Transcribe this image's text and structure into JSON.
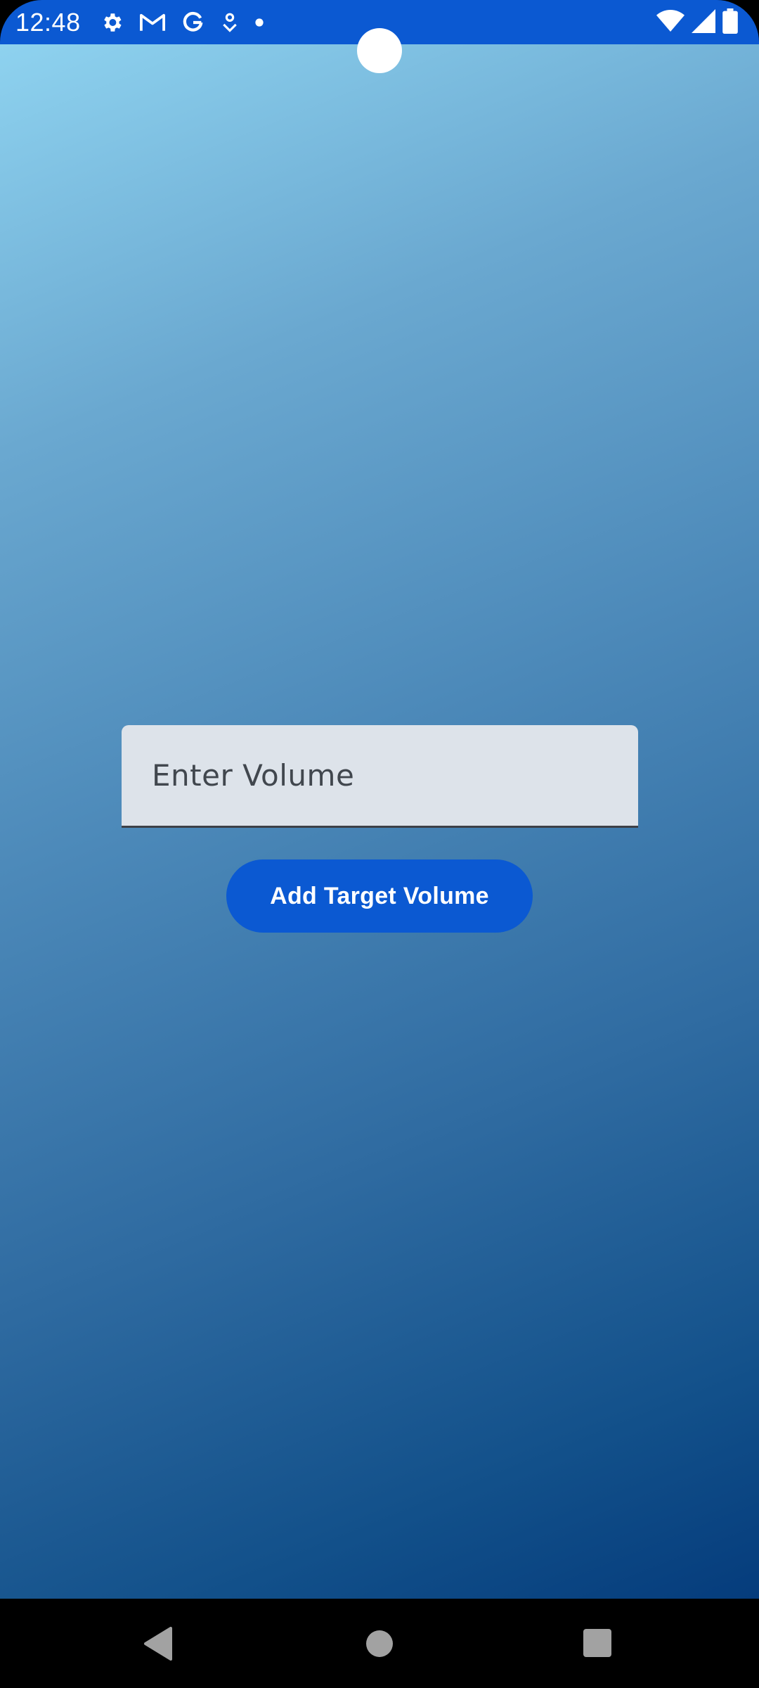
{
  "status_bar": {
    "time": "12:48",
    "left_icons": [
      "settings-icon",
      "gmail-icon",
      "google-icon",
      "location-pin-icon",
      "notification-dot-icon"
    ],
    "right_icons": [
      "wifi-icon",
      "signal-icon",
      "battery-icon"
    ],
    "background_color": "#0b59d2"
  },
  "main": {
    "volume_input": {
      "placeholder": "Enter Volume",
      "value": ""
    },
    "add_button_label": "Add Target Volume",
    "accent_color": "#0b59d2"
  },
  "nav_bar": {
    "buttons": [
      "back-icon",
      "home-icon",
      "recents-icon"
    ]
  }
}
